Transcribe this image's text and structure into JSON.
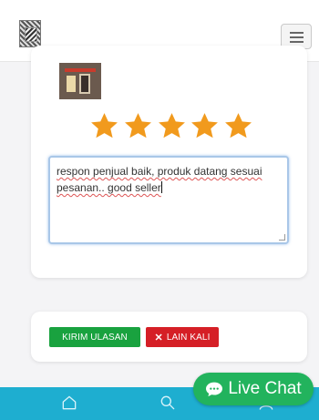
{
  "header": {
    "logo_icon": "logo-icon",
    "menu_icon": "hamburger-icon"
  },
  "review": {
    "rating": 5,
    "rating_max": 5,
    "star_color": "#f19a1d",
    "text": "respon penjual baik, produk datang sesuai pesanan.. good seller"
  },
  "actions": {
    "submit_label": "KIRIM ULASAN",
    "later_label": "LAIN KALI",
    "later_icon": "close-icon",
    "submit_color": "#19a23f",
    "later_color": "#d51f26"
  },
  "bottom_nav": {
    "color": "#1eaed0",
    "items": [
      "home-icon",
      "search-icon",
      "user-icon"
    ]
  },
  "live_chat": {
    "label": "Live Chat",
    "icon": "chat-bubble-icon",
    "color": "#22b35d"
  }
}
